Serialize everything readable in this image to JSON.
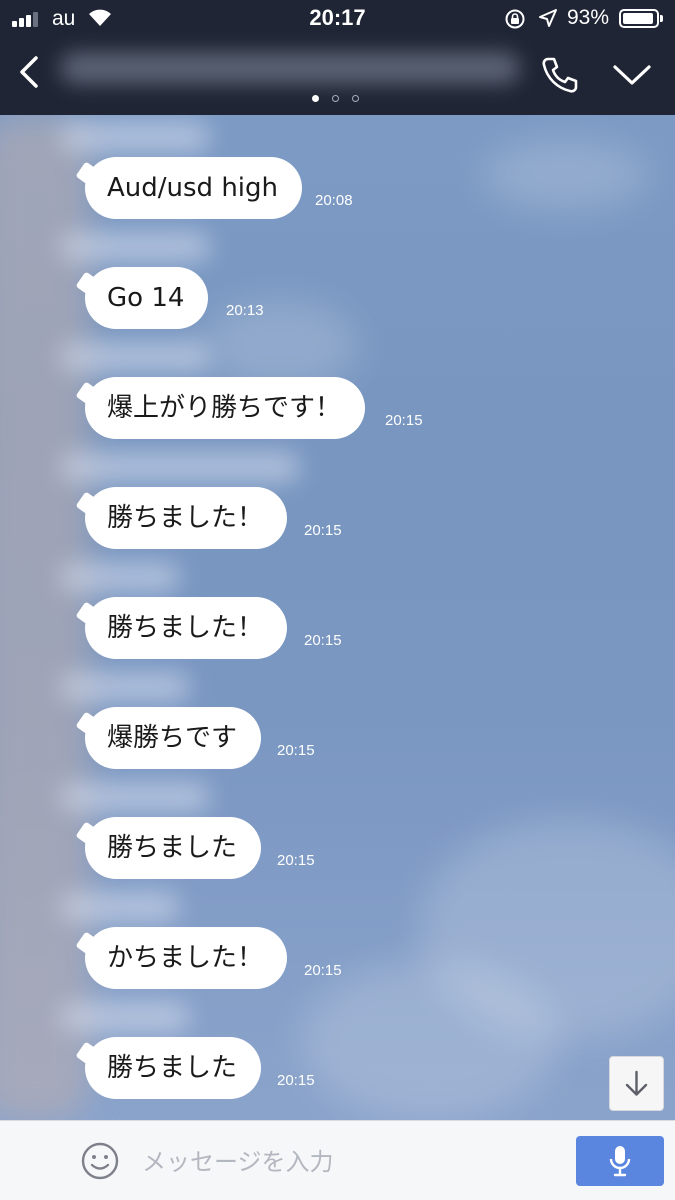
{
  "status_bar": {
    "carrier": "au",
    "time": "20:17",
    "battery_percent": "93%",
    "battery_level": 0.93,
    "icons": [
      "signal-icon",
      "wifi-icon",
      "rotation-lock-icon",
      "location-icon",
      "battery-icon"
    ]
  },
  "nav": {
    "back_icon": "chevron-left-icon",
    "call_icon": "phone-icon",
    "menu_icon": "chevron-down-icon",
    "page_dots": 3,
    "active_page_dot": 0
  },
  "messages": [
    {
      "text": "Aud/usd high",
      "time": "20:08"
    },
    {
      "text": "Go 14",
      "time": "20:13"
    },
    {
      "text": "爆上がり勝ちです！",
      "time": "20:15"
    },
    {
      "text": "勝ちました！",
      "time": "20:15"
    },
    {
      "text": "勝ちました！",
      "time": "20:15"
    },
    {
      "text": "爆勝ちです",
      "time": "20:15"
    },
    {
      "text": "勝ちました",
      "time": "20:15"
    },
    {
      "text": "かちました！",
      "time": "20:15"
    },
    {
      "text": "勝ちました",
      "time": "20:15"
    }
  ],
  "input": {
    "placeholder": "メッセージを入力",
    "value": "",
    "emoji_icon": "smiley-icon",
    "mic_icon": "microphone-icon"
  },
  "scroll_button_icon": "arrow-down-icon",
  "colors": {
    "header": "#1f2534",
    "background": "#7e9cc6",
    "bubble": "#ffffff",
    "mic_button": "#5b86df"
  }
}
